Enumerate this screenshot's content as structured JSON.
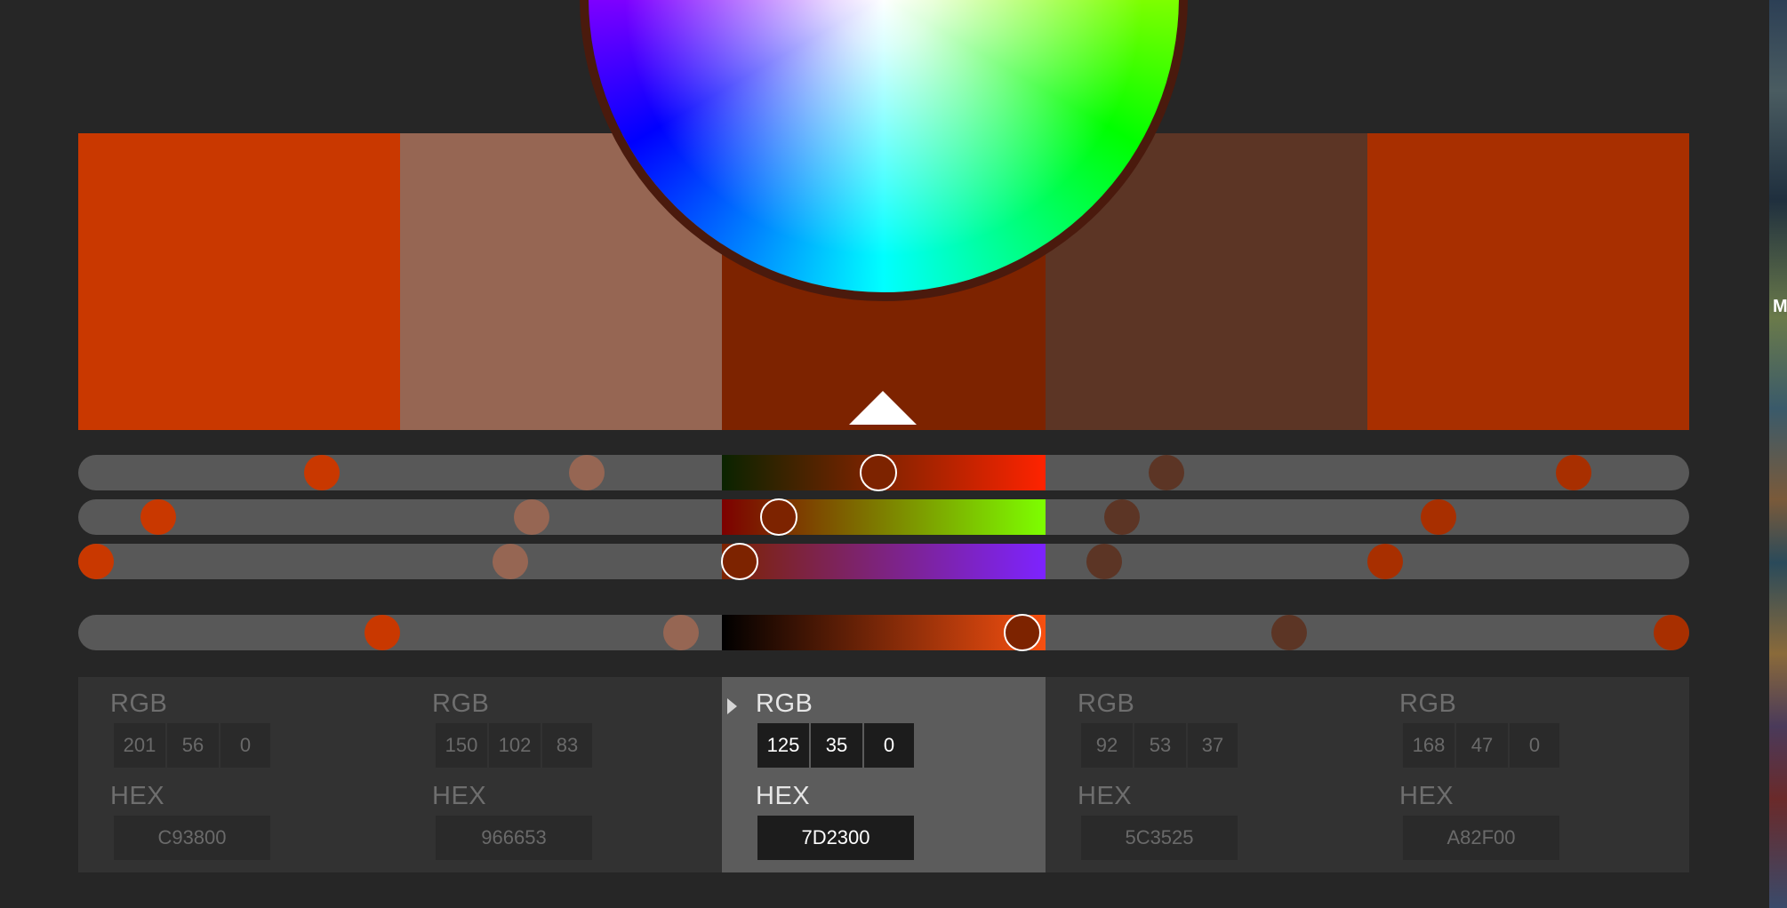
{
  "colors": [
    {
      "rgb_label": "RGB",
      "r": "201",
      "g": "56",
      "b": "0",
      "hex_label": "HEX",
      "hex": "C93800",
      "color": "#C93800"
    },
    {
      "rgb_label": "RGB",
      "r": "150",
      "g": "102",
      "b": "83",
      "hex_label": "HEX",
      "hex": "966653",
      "color": "#966653"
    },
    {
      "rgb_label": "RGB",
      "r": "125",
      "g": "35",
      "b": "0",
      "hex_label": "HEX",
      "hex": "7D2300",
      "color": "#7D2300",
      "active": true
    },
    {
      "rgb_label": "RGB",
      "r": "92",
      "g": "53",
      "b": "37",
      "hex_label": "HEX",
      "hex": "5C3525",
      "color": "#5C3525"
    },
    {
      "rgb_label": "RGB",
      "r": "168",
      "g": "47",
      "b": "0",
      "hex_label": "HEX",
      "hex": "A82F00",
      "color": "#A82F00"
    }
  ],
  "sliders": {
    "red": {
      "gradient_from": "#0a2300",
      "gradient_to": "#ff2300"
    },
    "green": {
      "gradient_from": "#7d0000",
      "gradient_to": "#7dff00"
    },
    "blue": {
      "gradient_from": "#7d2300",
      "gradient_to": "#7d23ff"
    },
    "brightness": {
      "gradient_from": "#000000",
      "gradient_to": "#f85010"
    }
  },
  "background": {
    "caption_fragment": "M"
  },
  "theme": {
    "background": "#262626",
    "panel": "#323232",
    "active_panel": "#5c5c5c",
    "track": "#585858"
  }
}
